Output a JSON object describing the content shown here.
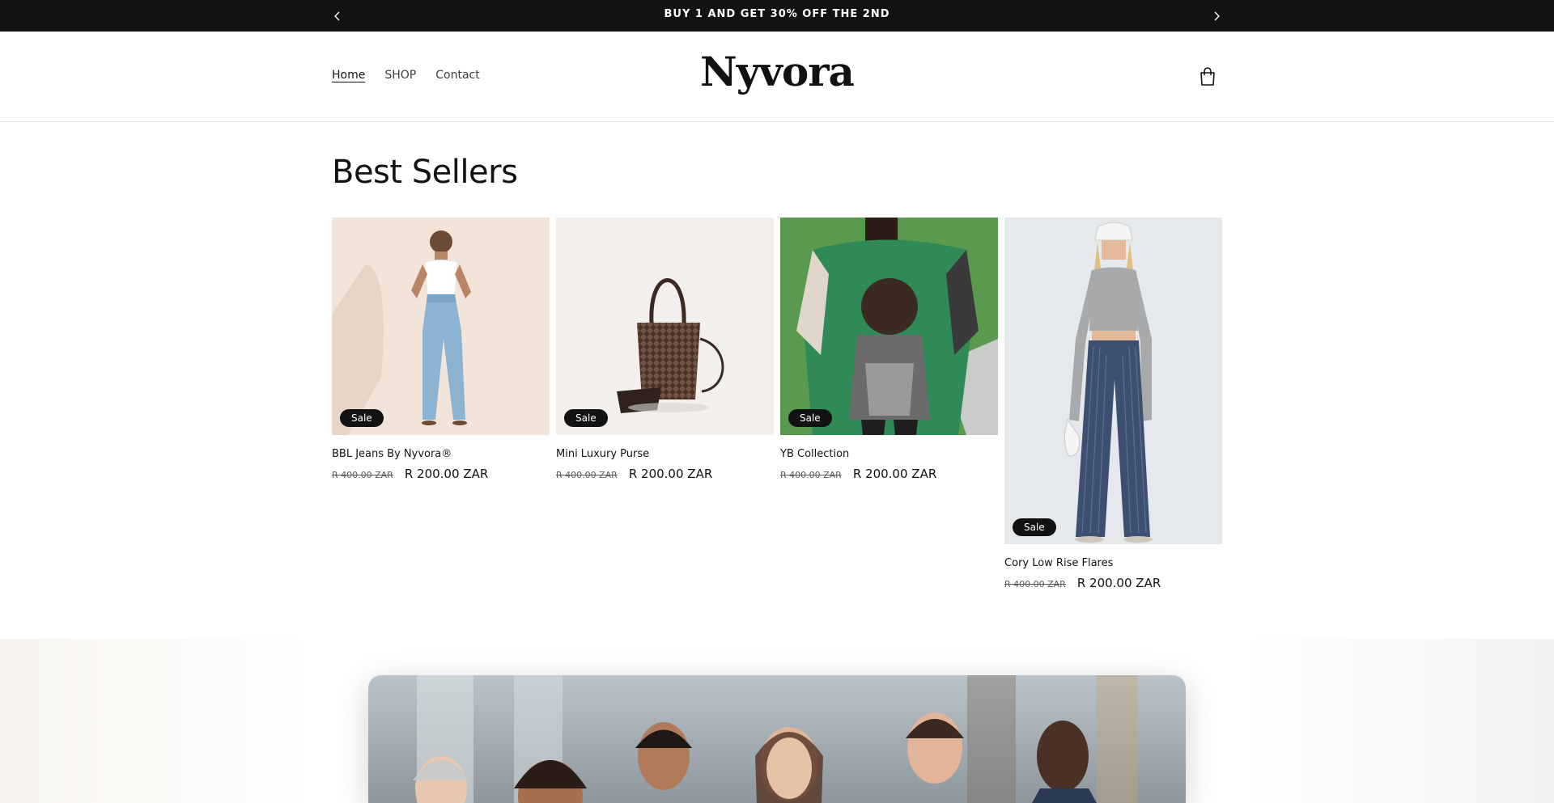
{
  "announcement": {
    "message": "BUY 1 AND GET 30% OFF THE 2ND"
  },
  "header": {
    "logo": "Nyvora",
    "nav": [
      "Home",
      "SHOP",
      "Contact"
    ]
  },
  "best_sellers": {
    "title": "Best Sellers",
    "products": [
      {
        "name": "BBL Jeans By Nyvora®",
        "badge": "Sale",
        "old_price": "R 400.00 ZAR",
        "price": "R 200.00 ZAR"
      },
      {
        "name": "Mini Luxury Purse",
        "badge": "Sale",
        "old_price": "R 400.00 ZAR",
        "price": "R 200.00 ZAR"
      },
      {
        "name": "YB Collection",
        "badge": "Sale",
        "old_price": "R 400.00 ZAR",
        "price": "R 200.00 ZAR"
      },
      {
        "name": "Cory Low Rise Flares",
        "badge": "Sale",
        "old_price": "R 400.00 ZAR",
        "price": "R 200.00 ZAR"
      }
    ]
  },
  "icons": {
    "prev": "chevron-left-icon",
    "next": "chevron-right-icon",
    "cart": "shopping-bag-icon"
  }
}
